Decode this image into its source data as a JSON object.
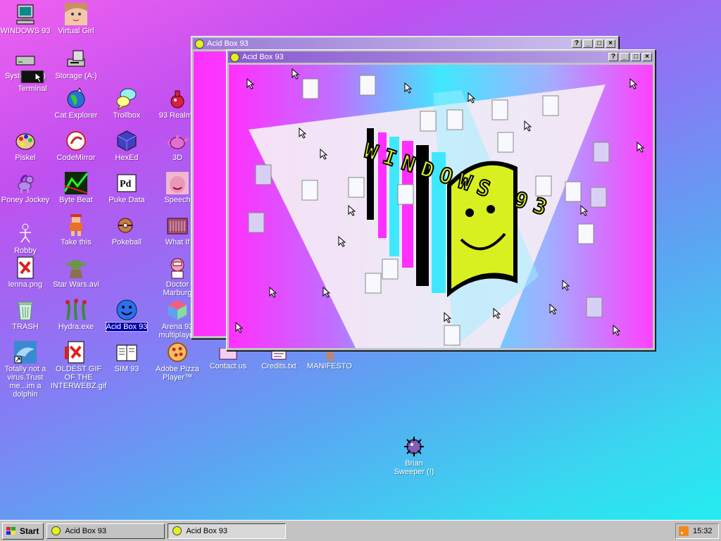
{
  "desktop": {
    "icons": [
      {
        "label": "WINDOWS 93",
        "icon": "computer-icon"
      },
      {
        "label": "Virtual Girl",
        "icon": "girl-face-icon"
      },
      {
        "label": "System (C:)",
        "icon": "hard-drive-icon"
      },
      {
        "label": "Storage (A:)",
        "icon": "floppy-drive-icon"
      },
      {
        "label": "Terminal",
        "icon": "terminal-icon"
      },
      {
        "label": "Cat Explorer",
        "icon": "globe-cat-icon"
      },
      {
        "label": "Trollbox",
        "icon": "chat-bubble-icon"
      },
      {
        "label": "93 Realms",
        "icon": "potion-icon"
      },
      {
        "label": "Piskel",
        "icon": "palette-icon"
      },
      {
        "label": "CodeMirror",
        "icon": "codemirror-icon"
      },
      {
        "label": "HexEd",
        "icon": "hex-cube-icon"
      },
      {
        "label": "3D",
        "icon": "teapot-icon"
      },
      {
        "label": "Poney Jockey",
        "icon": "pony-icon"
      },
      {
        "label": "Byte Beat",
        "icon": "bytebeat-icon"
      },
      {
        "label": "Puke Data",
        "icon": "puke-data-icon"
      },
      {
        "label": "Speech",
        "icon": "speech-face-icon"
      },
      {
        "label": "Robby",
        "icon": "stick-figure-icon"
      },
      {
        "label": "Take this",
        "icon": "take-this-icon"
      },
      {
        "label": "Pokeball",
        "icon": "pokeball-icon"
      },
      {
        "label": "What If",
        "icon": "what-if-icon"
      },
      {
        "label": "lenna.png",
        "icon": "image-file-icon"
      },
      {
        "label": "Star Wars.avi",
        "icon": "yoda-icon"
      },
      {
        "label": "Doctor Marburg",
        "icon": "doctor-icon"
      },
      {
        "label": "TRASH",
        "icon": "trash-icon"
      },
      {
        "label": "Hydra.exe",
        "icon": "hydra-icon"
      },
      {
        "label": "Acid Box 93",
        "icon": "acid-smiley-icon"
      },
      {
        "label": "Arena 93 multiplayer",
        "icon": "arena-cube-icon"
      },
      {
        "label": "Totally not a virus.Trust me...im a dolphin",
        "icon": "dolphin-icon"
      },
      {
        "label": "OLDEST GIF OF THE INTERWEBZ.gif",
        "icon": "gif-file-icon"
      },
      {
        "label": "SIM 93",
        "icon": "sim-icon"
      },
      {
        "label": "Adobe Pizza Player™",
        "icon": "pizza-icon"
      },
      {
        "label": "Contact us",
        "icon": "contact-icon"
      },
      {
        "label": "Credits.txt",
        "icon": "text-file-icon"
      },
      {
        "label": "MANIFESTO",
        "icon": "manifesto-icon"
      },
      {
        "label": "Brian Sweeper (!)",
        "icon": "mine-icon"
      }
    ]
  },
  "windows": [
    {
      "title": "Acid Box 93",
      "state": "inactive",
      "buttons": [
        "?",
        "_",
        "□",
        "×"
      ]
    },
    {
      "title": "Acid Box 93",
      "state": "active",
      "buttons": [
        "?",
        "_",
        "□",
        "×"
      ]
    }
  ],
  "acid_art": {
    "logo_text": "WINDOWS 93",
    "colors": {
      "magenta": "#ff30ff",
      "cyan": "#40e8ff",
      "lime": "#d8f020",
      "black": "#000000"
    }
  },
  "taskbar": {
    "start_label": "Start",
    "tasks": [
      {
        "label": "Acid Box 93",
        "active": false
      },
      {
        "label": "Acid Box 93",
        "active": true
      }
    ],
    "tray_icon": "rss-icon",
    "clock": "15:32"
  },
  "colors": {
    "desktop_gradient": [
      "#f060f0",
      "#8a78f4",
      "#20f0f0"
    ],
    "taskbar": "#c3c3c3",
    "selection": "#0000aa"
  }
}
